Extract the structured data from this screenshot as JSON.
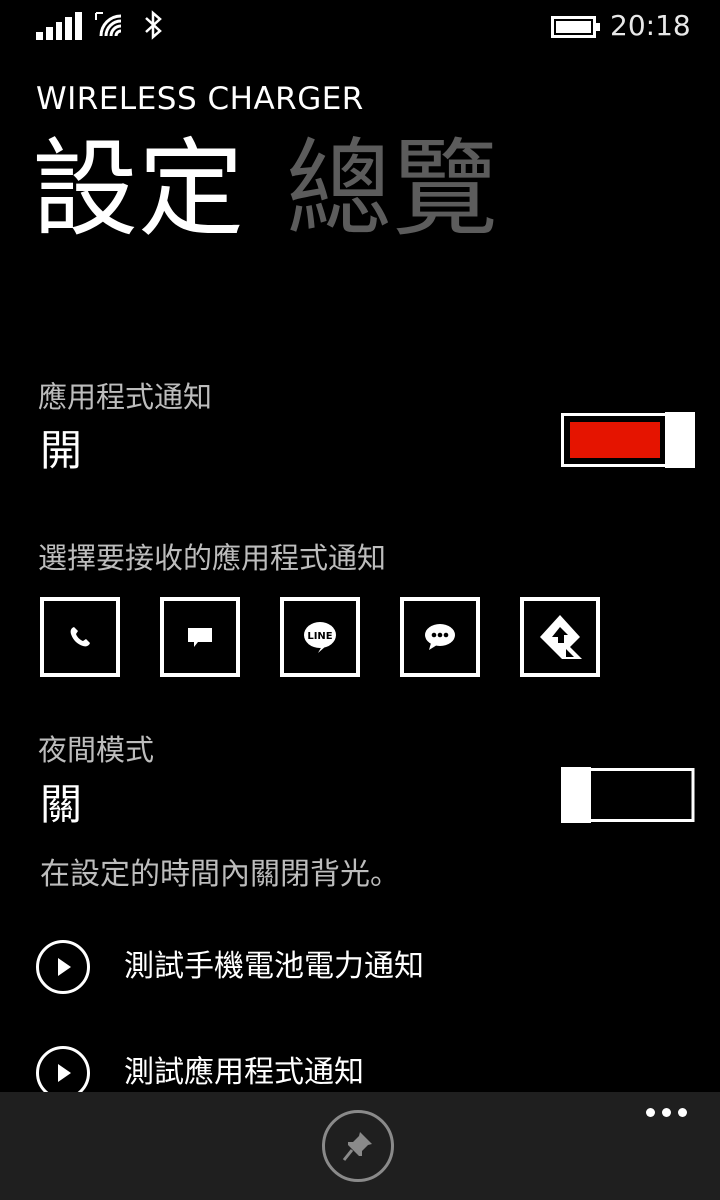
{
  "status_bar": {
    "time": "20:18",
    "icons": [
      "signal-icon",
      "wifi-icon",
      "bluetooth-icon",
      "battery-icon"
    ]
  },
  "app": {
    "title": "WIRELESS CHARGER"
  },
  "pivots": [
    {
      "label": "設定",
      "active": true
    },
    {
      "label": "總覽",
      "active": false
    }
  ],
  "app_notification": {
    "label": "應用程式通知",
    "value": "開",
    "toggle_on": true,
    "accent": "#e51400"
  },
  "app_selection": {
    "label": "選擇要接收的應用程式通知",
    "apps": [
      {
        "icon": "phone-icon"
      },
      {
        "icon": "message-icon"
      },
      {
        "icon": "line-icon",
        "text": "LINE"
      },
      {
        "icon": "chat-bubble-icon"
      },
      {
        "icon": "app-logo-icon"
      }
    ]
  },
  "night_mode": {
    "label": "夜間模式",
    "value": "關",
    "toggle_on": false,
    "description": "在設定的時間內關閉背光。"
  },
  "actions": [
    {
      "label": "測試手機電池電力通知",
      "icon": "play-icon"
    },
    {
      "label": "測試應用程式通知",
      "icon": "play-icon"
    }
  ],
  "app_bar": {
    "icons": [
      "pin-icon",
      "more-icon"
    ]
  }
}
